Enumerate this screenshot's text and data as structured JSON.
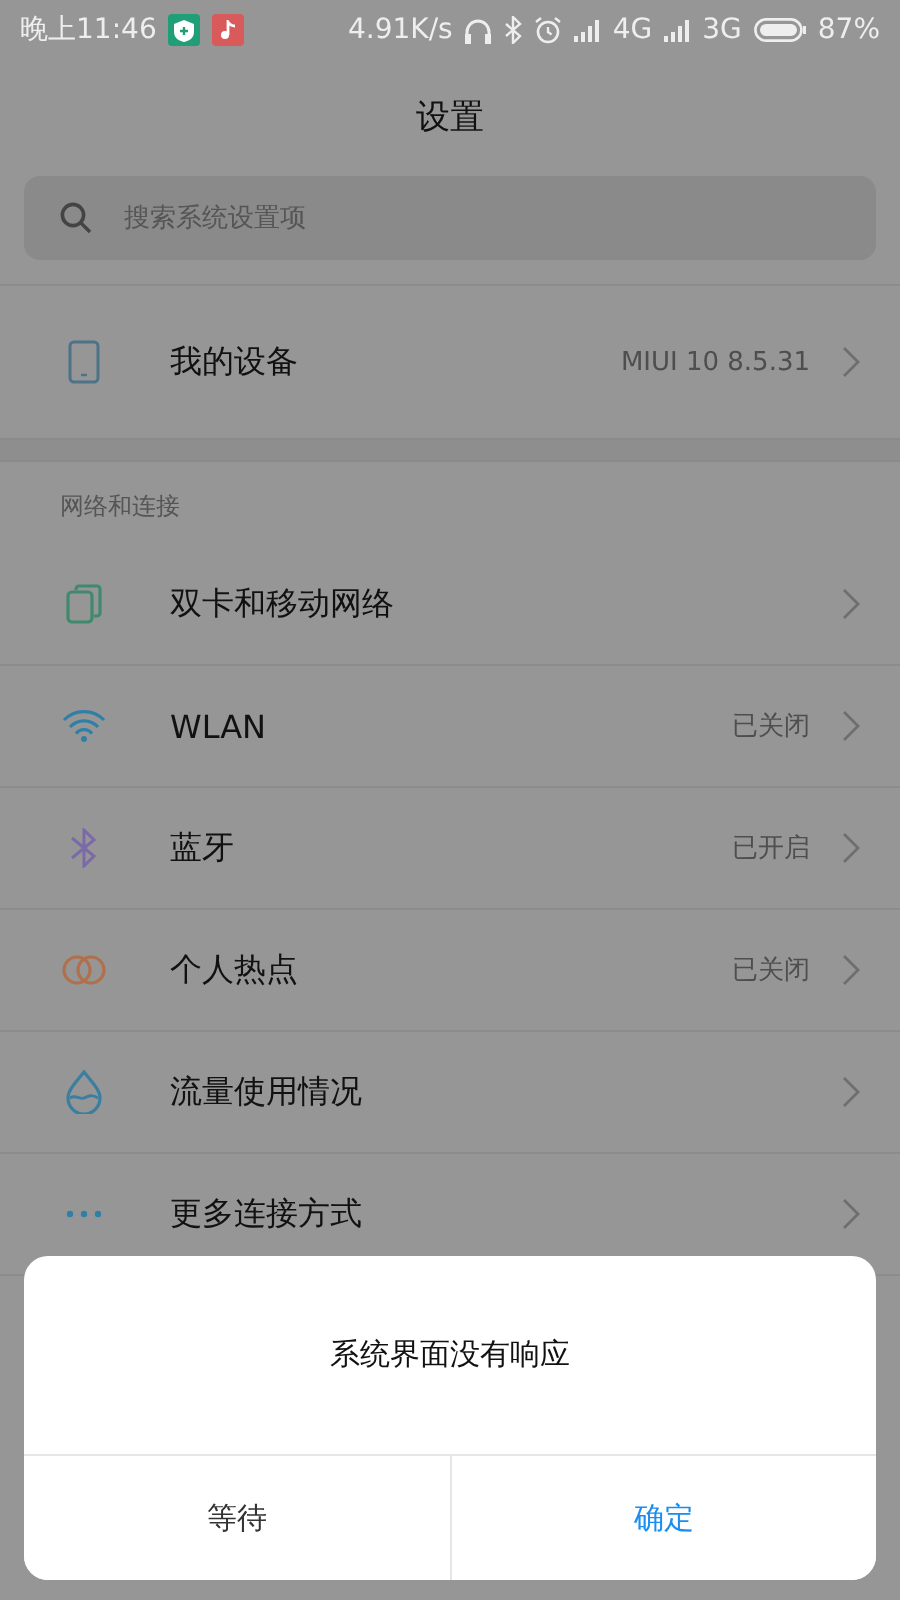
{
  "status_bar": {
    "time": "晚上11:46",
    "speed": "4.91K/s",
    "network_1": "4G",
    "network_2": "3G",
    "battery": "87%"
  },
  "header": {
    "title": "设置"
  },
  "search": {
    "placeholder": "搜索系统设置项"
  },
  "device": {
    "label": "我的设备",
    "value": "MIUI 10 8.5.31"
  },
  "section": {
    "title": "网络和连接",
    "items": [
      {
        "kind": "sim",
        "label": "双卡和移动网络"
      },
      {
        "kind": "wifi",
        "label": "WLAN",
        "value": "已关闭"
      },
      {
        "kind": "bluetooth",
        "label": "蓝牙",
        "value": "已开启"
      },
      {
        "kind": "hotspot",
        "label": "个人热点",
        "value": "已关闭"
      },
      {
        "kind": "data",
        "label": "流量使用情况"
      },
      {
        "kind": "more",
        "label": "更多连接方式"
      }
    ]
  },
  "dialog": {
    "message": "系统界面没有响应",
    "buttons": [
      {
        "kind": "normal",
        "label": "等待"
      },
      {
        "kind": "primary",
        "label": "确定"
      }
    ]
  }
}
